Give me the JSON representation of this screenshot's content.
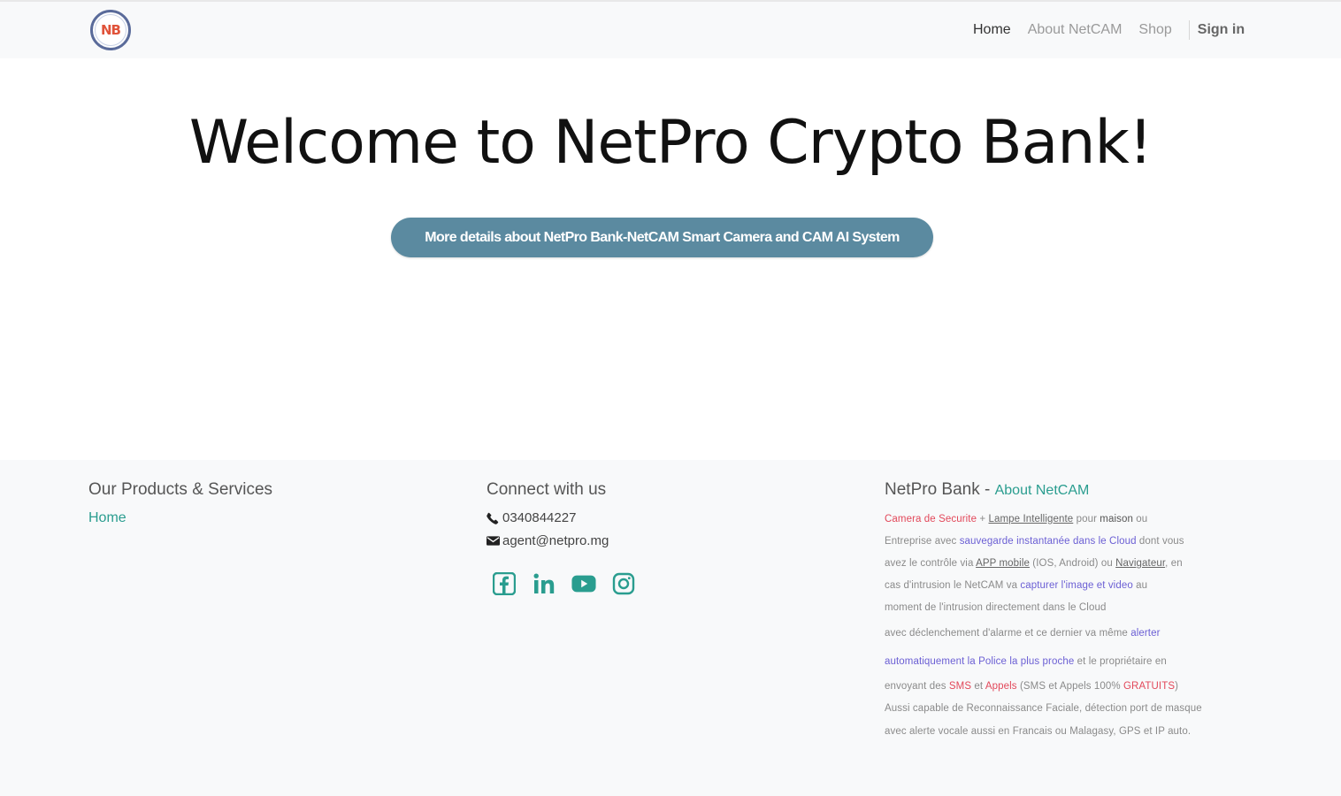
{
  "nav": {
    "logo_text": "NB",
    "links": [
      {
        "label": "Home"
      },
      {
        "label": "About NetCAM"
      },
      {
        "label": "Shop"
      }
    ],
    "signin": "Sign in"
  },
  "hero": {
    "title": "Welcome to NetPro Crypto Bank!",
    "button_label": "More details about NetPro Bank-NetCAM Smart Camera and CAM AI System"
  },
  "footer": {
    "products": {
      "title": "Our Products & Services",
      "link": "Home"
    },
    "connect": {
      "title": "Connect with us",
      "phone": "0340844227",
      "email": "agent@netpro.mg",
      "socials": [
        "facebook-icon",
        "linkedin-icon",
        "youtube-icon",
        "instagram-icon"
      ]
    },
    "about": {
      "title": "NetPro Bank - ",
      "link": "About NetCAM",
      "lines": [
        [
          {
            "t": "Camera de Securite",
            "c": "red"
          },
          {
            "t": " + ",
            "c": ""
          },
          {
            "t": "Lampe Intelligente",
            "c": "ul"
          },
          {
            "t": " pour ",
            "c": ""
          },
          {
            "t": "maison",
            "c": "dark"
          },
          {
            "t": " ou",
            "c": ""
          }
        ],
        [
          {
            "t": "Entreprise avec ",
            "c": ""
          },
          {
            "t": "sauvegarde instantanée dans le Cloud",
            "c": "blue"
          },
          {
            "t": " dont vous",
            "c": ""
          }
        ],
        [
          {
            "t": "avez le contrôle via ",
            "c": ""
          },
          {
            "t": "APP mobile",
            "c": "ul"
          },
          {
            "t": " (IOS, Android) ou ",
            "c": ""
          },
          {
            "t": "Navigateur",
            "c": "ul"
          },
          {
            "t": ", en",
            "c": ""
          }
        ],
        [
          {
            "t": "cas d'intrusion le NetCAM va ",
            "c": ""
          },
          {
            "t": "capturer l'image et video",
            "c": "blue"
          },
          {
            "t": " au",
            "c": ""
          }
        ],
        [
          {
            "t": "moment de l'intrusion directement dans le Cloud",
            "c": ""
          }
        ],
        [
          {
            "t": "avec déclenchement d'alarme et ce dernier va même ",
            "c": ""
          },
          {
            "t": "alerter",
            "c": "blue"
          }
        ],
        [
          {
            "t": "automatiquement la Police la plus proche",
            "c": "blue"
          },
          {
            "t": " et le propriétaire en",
            "c": ""
          }
        ],
        [
          {
            "t": "envoyant des ",
            "c": ""
          },
          {
            "t": "SMS",
            "c": "red"
          },
          {
            "t": " et ",
            "c": ""
          },
          {
            "t": "Appels",
            "c": "red"
          },
          {
            "t": " (SMS et Appels 100% ",
            "c": ""
          },
          {
            "t": "GRATUITS",
            "c": "red"
          },
          {
            "t": ")",
            "c": ""
          }
        ],
        [
          {
            "t": "Aussi capable de Reconnaissance Faciale, détection port de masque",
            "c": ""
          }
        ],
        [
          {
            "t": "avec alerte vocale aussi en Francais ou Malagasy, GPS et IP auto.",
            "c": ""
          }
        ]
      ]
    }
  },
  "colors": {
    "navbar_bg": "#f8f9fa",
    "accent": "#2a9d8f",
    "button_bg": "#5b8aa0",
    "footer_bg": "#f8f9fa"
  }
}
